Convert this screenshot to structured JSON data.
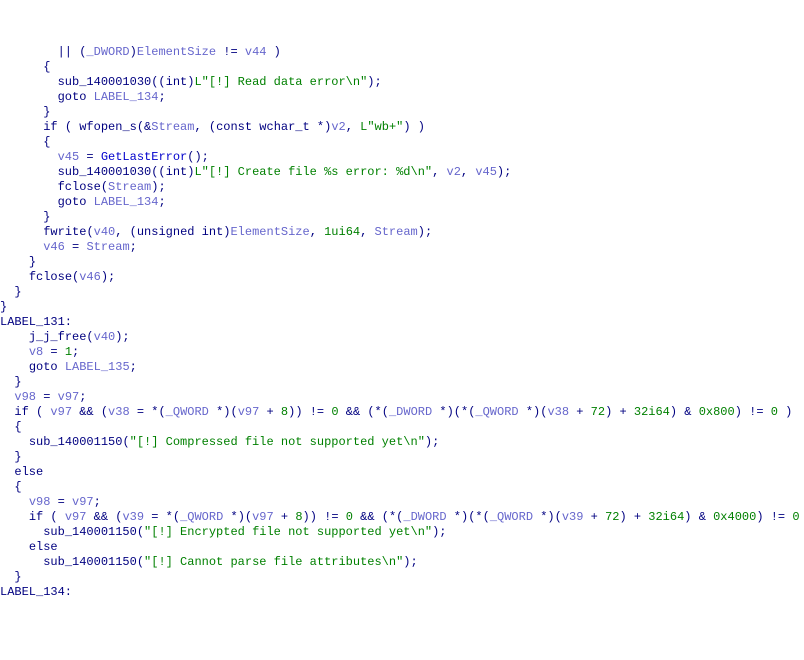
{
  "lines": [
    {
      "indent": "        ",
      "parts": [
        {
          "t": "|| (",
          "c": "plain"
        },
        {
          "t": "_DWORD",
          "c": "var"
        },
        {
          "t": ")",
          "c": "plain"
        },
        {
          "t": "ElementSize",
          "c": "var"
        },
        {
          "t": " != ",
          "c": "plain"
        },
        {
          "t": "v44",
          "c": "var"
        },
        {
          "t": " )",
          "c": "plain"
        }
      ]
    },
    {
      "indent": "      ",
      "parts": [
        {
          "t": "{",
          "c": "plain"
        }
      ]
    },
    {
      "indent": "        ",
      "parts": [
        {
          "t": "sub_140001030",
          "c": "fn"
        },
        {
          "t": "((",
          "c": "plain"
        },
        {
          "t": "int",
          "c": "kw"
        },
        {
          "t": ")",
          "c": "plain"
        },
        {
          "t": "L",
          "c": "num"
        },
        {
          "t": "\"[!] Read data error\\n\"",
          "c": "str"
        },
        {
          "t": ");",
          "c": "plain"
        }
      ]
    },
    {
      "indent": "        ",
      "parts": [
        {
          "t": "goto",
          "c": "kw"
        },
        {
          "t": " ",
          "c": "plain"
        },
        {
          "t": "LABEL_134",
          "c": "var"
        },
        {
          "t": ";",
          "c": "plain"
        }
      ]
    },
    {
      "indent": "      ",
      "parts": [
        {
          "t": "}",
          "c": "plain"
        }
      ]
    },
    {
      "indent": "      ",
      "parts": [
        {
          "t": "if",
          "c": "kw"
        },
        {
          "t": " ( ",
          "c": "plain"
        },
        {
          "t": "wfopen_s",
          "c": "fn"
        },
        {
          "t": "(&",
          "c": "plain"
        },
        {
          "t": "Stream",
          "c": "var"
        },
        {
          "t": ", (",
          "c": "plain"
        },
        {
          "t": "const",
          "c": "kw"
        },
        {
          "t": " ",
          "c": "plain"
        },
        {
          "t": "wchar_t",
          "c": "kw"
        },
        {
          "t": " *)",
          "c": "plain"
        },
        {
          "t": "v2",
          "c": "var"
        },
        {
          "t": ", ",
          "c": "plain"
        },
        {
          "t": "L",
          "c": "num"
        },
        {
          "t": "\"wb+\"",
          "c": "str"
        },
        {
          "t": ") )",
          "c": "plain"
        }
      ]
    },
    {
      "indent": "      ",
      "parts": [
        {
          "t": "{",
          "c": "plain"
        }
      ]
    },
    {
      "indent": "        ",
      "parts": [
        {
          "t": "v45",
          "c": "var"
        },
        {
          "t": " = ",
          "c": "plain"
        },
        {
          "t": "GetLastError",
          "c": "hdr"
        },
        {
          "t": "();",
          "c": "plain"
        }
      ]
    },
    {
      "indent": "        ",
      "parts": [
        {
          "t": "sub_140001030",
          "c": "fn"
        },
        {
          "t": "((",
          "c": "plain"
        },
        {
          "t": "int",
          "c": "kw"
        },
        {
          "t": ")",
          "c": "plain"
        },
        {
          "t": "L",
          "c": "num"
        },
        {
          "t": "\"[!] Create file %s error: %d\\n\"",
          "c": "str"
        },
        {
          "t": ", ",
          "c": "plain"
        },
        {
          "t": "v2",
          "c": "var"
        },
        {
          "t": ", ",
          "c": "plain"
        },
        {
          "t": "v45",
          "c": "var"
        },
        {
          "t": ");",
          "c": "plain"
        }
      ]
    },
    {
      "indent": "        ",
      "parts": [
        {
          "t": "fclose",
          "c": "fn"
        },
        {
          "t": "(",
          "c": "plain"
        },
        {
          "t": "Stream",
          "c": "var"
        },
        {
          "t": ");",
          "c": "plain"
        }
      ]
    },
    {
      "indent": "        ",
      "parts": [
        {
          "t": "goto",
          "c": "kw"
        },
        {
          "t": " ",
          "c": "plain"
        },
        {
          "t": "LABEL_134",
          "c": "var"
        },
        {
          "t": ";",
          "c": "plain"
        }
      ]
    },
    {
      "indent": "      ",
      "parts": [
        {
          "t": "}",
          "c": "plain"
        }
      ]
    },
    {
      "indent": "      ",
      "parts": [
        {
          "t": "fwrite",
          "c": "fn"
        },
        {
          "t": "(",
          "c": "plain"
        },
        {
          "t": "v40",
          "c": "var"
        },
        {
          "t": ", (",
          "c": "plain"
        },
        {
          "t": "unsigned",
          "c": "kw"
        },
        {
          "t": " ",
          "c": "plain"
        },
        {
          "t": "int",
          "c": "kw"
        },
        {
          "t": ")",
          "c": "plain"
        },
        {
          "t": "ElementSize",
          "c": "var"
        },
        {
          "t": ", ",
          "c": "plain"
        },
        {
          "t": "1ui64",
          "c": "num"
        },
        {
          "t": ", ",
          "c": "plain"
        },
        {
          "t": "Stream",
          "c": "var"
        },
        {
          "t": ");",
          "c": "plain"
        }
      ]
    },
    {
      "indent": "      ",
      "parts": [
        {
          "t": "v46",
          "c": "var"
        },
        {
          "t": " = ",
          "c": "plain"
        },
        {
          "t": "Stream",
          "c": "var"
        },
        {
          "t": ";",
          "c": "plain"
        }
      ]
    },
    {
      "indent": "    ",
      "parts": [
        {
          "t": "}",
          "c": "plain"
        }
      ]
    },
    {
      "indent": "    ",
      "parts": [
        {
          "t": "fclose",
          "c": "fn"
        },
        {
          "t": "(",
          "c": "plain"
        },
        {
          "t": "v46",
          "c": "var"
        },
        {
          "t": ");",
          "c": "plain"
        }
      ]
    },
    {
      "indent": "  ",
      "parts": [
        {
          "t": "}",
          "c": "plain"
        }
      ]
    },
    {
      "indent": "",
      "parts": [
        {
          "t": "}",
          "c": "plain"
        }
      ]
    },
    {
      "indent": "",
      "parts": [
        {
          "t": "LABEL_131:",
          "c": "label"
        }
      ]
    },
    {
      "indent": "    ",
      "parts": [
        {
          "t": "j_j_free",
          "c": "fn"
        },
        {
          "t": "(",
          "c": "plain"
        },
        {
          "t": "v40",
          "c": "var"
        },
        {
          "t": ");",
          "c": "plain"
        }
      ]
    },
    {
      "indent": "    ",
      "parts": [
        {
          "t": "v8",
          "c": "var"
        },
        {
          "t": " = ",
          "c": "plain"
        },
        {
          "t": "1",
          "c": "num"
        },
        {
          "t": ";",
          "c": "plain"
        }
      ]
    },
    {
      "indent": "    ",
      "parts": [
        {
          "t": "goto",
          "c": "kw"
        },
        {
          "t": " ",
          "c": "plain"
        },
        {
          "t": "LABEL_135",
          "c": "var"
        },
        {
          "t": ";",
          "c": "plain"
        }
      ]
    },
    {
      "indent": "  ",
      "parts": [
        {
          "t": "}",
          "c": "plain"
        }
      ]
    },
    {
      "indent": "  ",
      "parts": [
        {
          "t": "v98",
          "c": "var"
        },
        {
          "t": " = ",
          "c": "plain"
        },
        {
          "t": "v97",
          "c": "var"
        },
        {
          "t": ";",
          "c": "plain"
        }
      ]
    },
    {
      "indent": "  ",
      "parts": [
        {
          "t": "if",
          "c": "kw"
        },
        {
          "t": " ( ",
          "c": "plain"
        },
        {
          "t": "v97",
          "c": "var"
        },
        {
          "t": " && (",
          "c": "plain"
        },
        {
          "t": "v38",
          "c": "var"
        },
        {
          "t": " = *(",
          "c": "plain"
        },
        {
          "t": "_QWORD",
          "c": "var"
        },
        {
          "t": " *)(",
          "c": "plain"
        },
        {
          "t": "v97",
          "c": "var"
        },
        {
          "t": " + ",
          "c": "plain"
        },
        {
          "t": "8",
          "c": "num"
        },
        {
          "t": ")) != ",
          "c": "plain"
        },
        {
          "t": "0",
          "c": "num"
        },
        {
          "t": " && (*(",
          "c": "plain"
        },
        {
          "t": "_DWORD",
          "c": "var"
        },
        {
          "t": " *)(*(",
          "c": "plain"
        },
        {
          "t": "_QWORD",
          "c": "var"
        },
        {
          "t": " *)(",
          "c": "plain"
        },
        {
          "t": "v38",
          "c": "var"
        },
        {
          "t": " + ",
          "c": "plain"
        },
        {
          "t": "72",
          "c": "num"
        },
        {
          "t": ") + ",
          "c": "plain"
        },
        {
          "t": "32i64",
          "c": "num"
        },
        {
          "t": ") & ",
          "c": "plain"
        },
        {
          "t": "0x800",
          "c": "num"
        },
        {
          "t": ") != ",
          "c": "plain"
        },
        {
          "t": "0",
          "c": "num"
        },
        {
          "t": " )",
          "c": "plain"
        }
      ]
    },
    {
      "indent": "  ",
      "parts": [
        {
          "t": "{",
          "c": "plain"
        }
      ]
    },
    {
      "indent": "    ",
      "parts": [
        {
          "t": "sub_140001150",
          "c": "fn"
        },
        {
          "t": "(",
          "c": "plain"
        },
        {
          "t": "\"[!] Compressed file not supported yet\\n\"",
          "c": "str"
        },
        {
          "t": ");",
          "c": "plain"
        }
      ]
    },
    {
      "indent": "  ",
      "parts": [
        {
          "t": "}",
          "c": "plain"
        }
      ]
    },
    {
      "indent": "  ",
      "parts": [
        {
          "t": "else",
          "c": "kw"
        }
      ]
    },
    {
      "indent": "  ",
      "parts": [
        {
          "t": "{",
          "c": "plain"
        }
      ]
    },
    {
      "indent": "    ",
      "parts": [
        {
          "t": "v98",
          "c": "var"
        },
        {
          "t": " = ",
          "c": "plain"
        },
        {
          "t": "v97",
          "c": "var"
        },
        {
          "t": ";",
          "c": "plain"
        }
      ]
    },
    {
      "indent": "    ",
      "parts": [
        {
          "t": "if",
          "c": "kw"
        },
        {
          "t": " ( ",
          "c": "plain"
        },
        {
          "t": "v97",
          "c": "var"
        },
        {
          "t": " && (",
          "c": "plain"
        },
        {
          "t": "v39",
          "c": "var"
        },
        {
          "t": " = *(",
          "c": "plain"
        },
        {
          "t": "_QWORD",
          "c": "var"
        },
        {
          "t": " *)(",
          "c": "plain"
        },
        {
          "t": "v97",
          "c": "var"
        },
        {
          "t": " + ",
          "c": "plain"
        },
        {
          "t": "8",
          "c": "num"
        },
        {
          "t": ")) != ",
          "c": "plain"
        },
        {
          "t": "0",
          "c": "num"
        },
        {
          "t": " && (*(",
          "c": "plain"
        },
        {
          "t": "_DWORD",
          "c": "var"
        },
        {
          "t": " *)(*(",
          "c": "plain"
        },
        {
          "t": "_QWORD",
          "c": "var"
        },
        {
          "t": " *)(",
          "c": "plain"
        },
        {
          "t": "v39",
          "c": "var"
        },
        {
          "t": " + ",
          "c": "plain"
        },
        {
          "t": "72",
          "c": "num"
        },
        {
          "t": ") + ",
          "c": "plain"
        },
        {
          "t": "32i64",
          "c": "num"
        },
        {
          "t": ") & ",
          "c": "plain"
        },
        {
          "t": "0x4000",
          "c": "num"
        },
        {
          "t": ") != ",
          "c": "plain"
        },
        {
          "t": "0",
          "c": "num"
        },
        {
          "t": " )",
          "c": "plain"
        }
      ]
    },
    {
      "indent": "      ",
      "parts": [
        {
          "t": "sub_140001150",
          "c": "fn"
        },
        {
          "t": "(",
          "c": "plain"
        },
        {
          "t": "\"[!] Encrypted file not supported yet\\n\"",
          "c": "str"
        },
        {
          "t": ");",
          "c": "plain"
        }
      ]
    },
    {
      "indent": "    ",
      "parts": [
        {
          "t": "else",
          "c": "kw"
        }
      ]
    },
    {
      "indent": "      ",
      "parts": [
        {
          "t": "sub_140001150",
          "c": "fn"
        },
        {
          "t": "(",
          "c": "plain"
        },
        {
          "t": "\"[!] Cannot parse file attributes\\n\"",
          "c": "str"
        },
        {
          "t": ");",
          "c": "plain"
        }
      ]
    },
    {
      "indent": "  ",
      "parts": [
        {
          "t": "}",
          "c": "plain"
        }
      ]
    },
    {
      "indent": "",
      "parts": [
        {
          "t": "LABEL_134:",
          "c": "label"
        }
      ]
    }
  ]
}
